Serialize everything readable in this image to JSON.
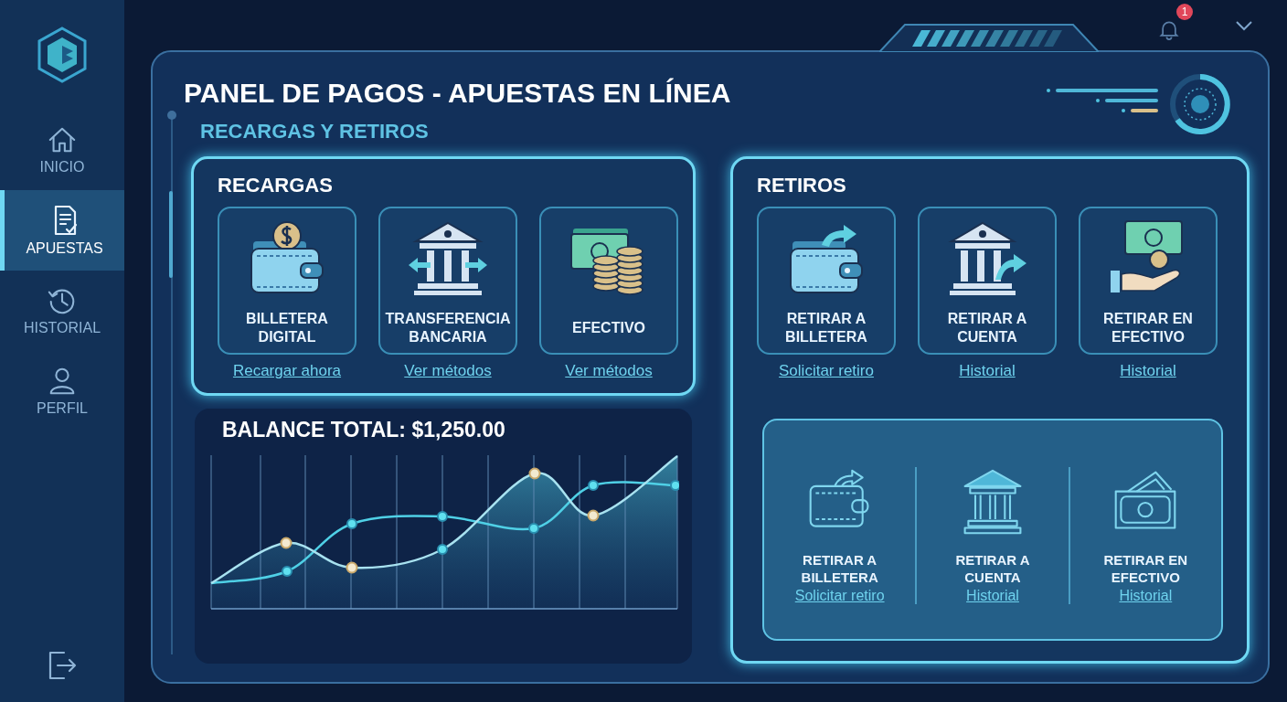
{
  "sidebar": {
    "items": [
      {
        "kind": "home",
        "label": "INICIO",
        "selected": false
      },
      {
        "kind": "document",
        "label": "APUESTAS",
        "selected": true
      },
      {
        "kind": "history",
        "label": "HISTORIAL",
        "selected": false
      },
      {
        "kind": "user",
        "label": "PERFIL",
        "selected": false
      }
    ]
  },
  "notifications": {
    "badge": "1"
  },
  "title": "PANEL DE PAGOS - APUESTAS EN LÍNEA",
  "section_title": "RECARGAS Y RETIROS",
  "recargas": {
    "title": "RECARGAS",
    "options": [
      {
        "kind": "wallet-coin",
        "label": "BILLETERA DIGITAL",
        "link": "Recargar ahora"
      },
      {
        "kind": "bank-arrows",
        "label": "TRANSFERENCIA BANCARIA",
        "link": "Ver métodos"
      },
      {
        "kind": "cash-coins",
        "label": "EFECTIVO",
        "link": "Ver métodos"
      }
    ]
  },
  "balance": {
    "label": "BALANCE TOTAL: $1,250.00"
  },
  "retiros": {
    "title": "RETIROS",
    "options": [
      {
        "kind": "wallet-out",
        "label": "RETIRAR A BILLETERA",
        "link": "Solicitar retiro"
      },
      {
        "kind": "bank-out",
        "label": "RETIRAR A CUENTA",
        "link": "Historial"
      },
      {
        "kind": "cash-hand",
        "label": "RETIRAR EN EFECTIVO",
        "link": "Historial"
      }
    ],
    "summary": [
      {
        "kind": "wallet-out",
        "label": "RETIRAR A BILLETERA",
        "link": "Solicitar retiro"
      },
      {
        "kind": "bank",
        "label": "RETIRAR A CUENTA",
        "link": "Historial"
      },
      {
        "kind": "cash",
        "label": "RETIRAR EN EFECTIVO",
        "link": "Historial"
      }
    ]
  }
}
